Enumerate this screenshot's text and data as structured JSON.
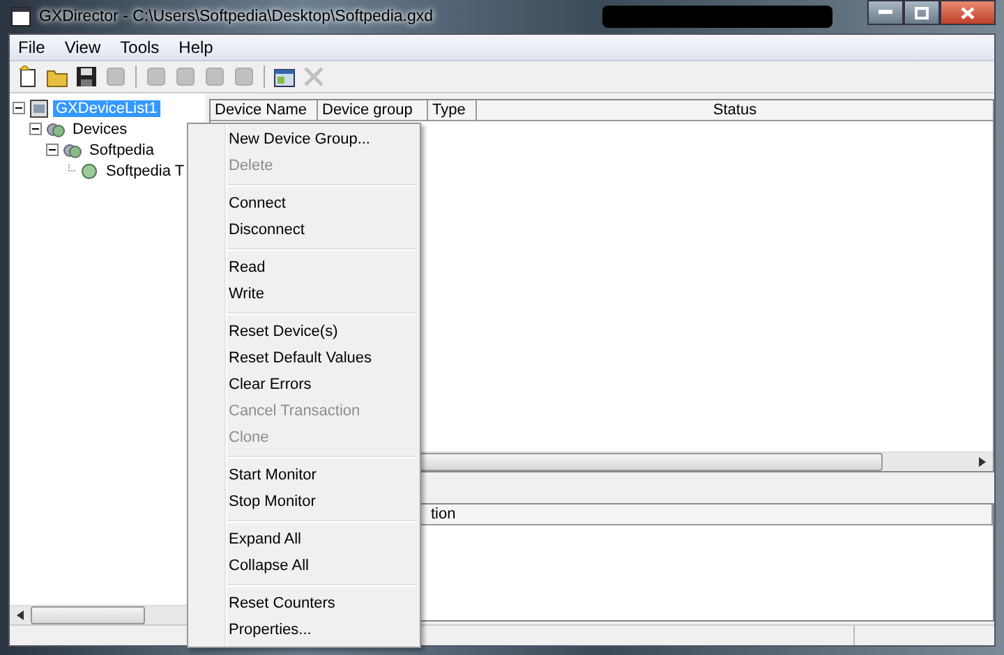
{
  "window": {
    "title": "GXDirector - C:\\Users\\Softpedia\\Desktop\\Softpedia.gxd"
  },
  "menu_bar": [
    "File",
    "View",
    "Tools",
    "Help"
  ],
  "toolbar": [
    {
      "kind": "new",
      "disabled": false
    },
    {
      "kind": "open",
      "disabled": false
    },
    {
      "kind": "save",
      "disabled": false
    },
    {
      "kind": "device",
      "disabled": true
    },
    {
      "kind": "separator"
    },
    {
      "kind": "device",
      "disabled": true
    },
    {
      "kind": "device",
      "disabled": true
    },
    {
      "kind": "device",
      "disabled": true
    },
    {
      "kind": "device",
      "disabled": true
    },
    {
      "kind": "separator"
    },
    {
      "kind": "properties",
      "disabled": false
    },
    {
      "kind": "remove",
      "disabled": true
    }
  ],
  "tree": [
    {
      "label": "GXDeviceList1",
      "selected": true,
      "expanded": true,
      "kind": "list",
      "children": [
        {
          "label": "Devices",
          "selected": false,
          "expanded": true,
          "kind": "group",
          "children": [
            {
              "label": "Softpedia",
              "selected": false,
              "expanded": true,
              "kind": "group",
              "children": [
                {
                  "label": "Softpedia T",
                  "selected": false,
                  "kind": "device"
                }
              ]
            }
          ]
        }
      ]
    }
  ],
  "device_table": {
    "columns": [
      "Device Name",
      "Device group",
      "Type",
      "Status"
    ]
  },
  "trace_table": {
    "columns": [
      "tion"
    ]
  },
  "context_menu": [
    {
      "kind": "item",
      "label": "New Device Group...",
      "disabled": false
    },
    {
      "kind": "item",
      "label": "Delete",
      "disabled": true
    },
    {
      "kind": "separator"
    },
    {
      "kind": "item",
      "label": "Connect",
      "disabled": false
    },
    {
      "kind": "item",
      "label": "Disconnect",
      "disabled": false
    },
    {
      "kind": "separator"
    },
    {
      "kind": "item",
      "label": "Read",
      "disabled": false
    },
    {
      "kind": "item",
      "label": "Write",
      "disabled": false
    },
    {
      "kind": "separator"
    },
    {
      "kind": "item",
      "label": "Reset Device(s)",
      "disabled": false
    },
    {
      "kind": "item",
      "label": "Reset Default Values",
      "disabled": false
    },
    {
      "kind": "item",
      "label": "Clear Errors",
      "disabled": false
    },
    {
      "kind": "item",
      "label": "Cancel Transaction",
      "disabled": true
    },
    {
      "kind": "item",
      "label": "Clone",
      "disabled": true
    },
    {
      "kind": "separator"
    },
    {
      "kind": "item",
      "label": "Start Monitor",
      "disabled": false
    },
    {
      "kind": "item",
      "label": "Stop Monitor",
      "disabled": false
    },
    {
      "kind": "separator"
    },
    {
      "kind": "item",
      "label": "Expand All",
      "disabled": false
    },
    {
      "kind": "item",
      "label": "Collapse All",
      "disabled": false
    },
    {
      "kind": "separator"
    },
    {
      "kind": "item",
      "label": "Reset Counters",
      "disabled": false
    },
    {
      "kind": "item",
      "label": "Properties...",
      "disabled": false
    }
  ]
}
